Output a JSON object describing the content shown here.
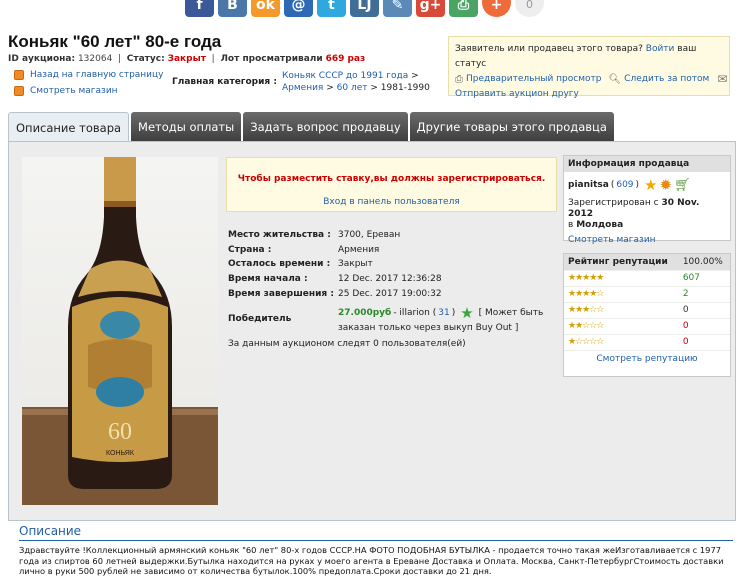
{
  "share": {
    "buttons": [
      {
        "name": "facebook-share-button",
        "glyph": "f",
        "color": "#3b5998"
      },
      {
        "name": "vkontakte-share-button",
        "glyph": "B",
        "color": "#4a76a8"
      },
      {
        "name": "odnoklassniki-share-button",
        "glyph": "ok",
        "color": "#f59a2a"
      },
      {
        "name": "mailru-share-button",
        "glyph": "@",
        "color": "#2d6ab3"
      },
      {
        "name": "twitter-share-button",
        "glyph": "t",
        "color": "#2fa8e0"
      },
      {
        "name": "livejournal-share-button",
        "glyph": "LJ",
        "color": "#3f6f96"
      },
      {
        "name": "feather-share-button",
        "glyph": "✎",
        "color": "#5a8bb8"
      },
      {
        "name": "googleplus-share-button",
        "glyph": "g+",
        "color": "#d8493a"
      },
      {
        "name": "print-share-button",
        "glyph": "⎙",
        "color": "#4aa564"
      },
      {
        "name": "more-share-button",
        "glyph": "+",
        "color": "#ef6b3a"
      }
    ],
    "count": "0"
  },
  "title": "Коньяк \"60 лет\" 80-е года",
  "meta": {
    "id_label": "ID аукциона:",
    "id_value": "132064",
    "status_label": "Статус:",
    "status_value": "Закрыт",
    "views_label": "Лот просматривали",
    "views_value": "669 раз"
  },
  "nav": {
    "back": "Назад на главную страницу",
    "shop": "Смотреть магазин"
  },
  "category": {
    "label": "Главная категория :",
    "path1": "Коньяк СССР до 1991 года",
    "sep": ">",
    "path2": "Армения",
    "path3": "60 лет",
    "path4": "1981-1990"
  },
  "seller_box": {
    "question": "Заявитель или продавец этого товара?",
    "login": "Войти",
    "login_suffix": "ваш статус",
    "preview": "Предварительный просмотр",
    "watch": "Следить за потом",
    "send": "Отправить аукцион другу"
  },
  "tabs": [
    "Описание товара",
    "Методы оплаты",
    "Задать вопрос продавцу",
    "Другие товары этого продавца"
  ],
  "notice": {
    "message": "Чтобы разместить ставку,вы должны зарегистрироваться.",
    "link": "Вход в панель пользователя"
  },
  "info": [
    {
      "label": "Место жительства :",
      "value": "3700, Ереван"
    },
    {
      "label": "Страна :",
      "value": "Армения"
    },
    {
      "label": "Осталось времени :",
      "value": "Закрыт"
    },
    {
      "label": "Время начала :",
      "value": "12 Dec. 2017 12:36:28"
    },
    {
      "label": "Время завершения :",
      "value": "25 Dec. 2017 19:00:32"
    }
  ],
  "winner": {
    "label": "Победитель",
    "price": "27.000руб",
    "user_prefix": "- illarion (",
    "user_rating": "31",
    "user_suffix": ")",
    "note_line1": "[ Может быть",
    "note_line2": "заказан только через выкуп Buy Out ]"
  },
  "watchers": "За данным аукционом следят 0 пользователя(ей)",
  "photo": {
    "label_number": "60",
    "label_word": "КОНЬЯК"
  },
  "seller_info": {
    "heading": "Информация продавца",
    "name": "pianitsa",
    "rating_open": "(",
    "rating": "609",
    "rating_close": ")",
    "registered_prefix": "Зарегистрирован с",
    "registered_date": "30 Nov. 2012",
    "location_prefix": "в",
    "location": "Молдова",
    "shop_link": "Смотреть магазин"
  },
  "reputation": {
    "heading": "Рейтинг репутации",
    "percent": "100.00%",
    "rows": [
      {
        "stars": "★★★★★",
        "count": "607",
        "color": "#2a8a2a"
      },
      {
        "stars": "★★★★☆",
        "count": "2",
        "color": "#2a8a2a"
      },
      {
        "stars": "★★★☆☆",
        "count": "0",
        "color": "#333333"
      },
      {
        "stars": "★★☆☆☆",
        "count": "0",
        "color": "#cc0000"
      },
      {
        "stars": "★☆☆☆☆",
        "count": "0",
        "color": "#cc0000"
      }
    ],
    "link": "Смотреть репутацию"
  },
  "description": {
    "heading": "Описание",
    "text": "Здравствуйте !Коллекционный армянский коньяк \"60 лет\" 80-х годов СССР.НА ФОТО ПОДОБНАЯ БУТЫЛКА - продается точно такая жеИзготавливается с 1977 года из спиртов 60 летней выдержки.Бутылка находится на руках у моего агента в Ереване Доставка и Оплата. Москва, Санкт-ПетербургСтоимость доставки лично в руки 500 рублей не зависимо от количества бутылок.100% предоплата.Сроки доставки до 21 дня."
  }
}
